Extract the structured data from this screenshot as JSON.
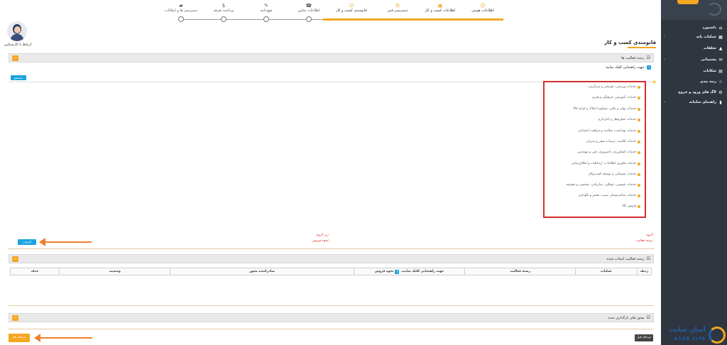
{
  "sidebar": {
    "items": [
      {
        "label": "داشبورد",
        "icon": "home-icon",
        "glyph": "⌂",
        "chevron": false
      },
      {
        "label": "عملیات پایه",
        "icon": "grid-icon",
        "glyph": "▦",
        "chevron": true
      },
      {
        "label": "تخلفات",
        "icon": "warning-icon",
        "glyph": "▲",
        "chevron": false
      },
      {
        "label": "پشتیبانی",
        "icon": "chat-icon",
        "glyph": "✉",
        "chevron": true
      },
      {
        "label": "شکایات",
        "icon": "document-icon",
        "glyph": "▤",
        "chevron": false
      },
      {
        "label": "رتبه بندی",
        "icon": "rating-icon",
        "glyph": "☆",
        "chevron": false
      },
      {
        "label": "لاگ های ورود و خروج",
        "icon": "log-icon",
        "glyph": "⚙",
        "chevron": false
      },
      {
        "label": "راهنمای سامانه",
        "icon": "help-icon",
        "glyph": "▮",
        "chevron": true
      }
    ]
  },
  "stepper": {
    "steps": [
      {
        "label": "اطلاعات هویتی",
        "glyph": "☺",
        "icon": "user-icon",
        "done": true
      },
      {
        "label": "اطلاعات کسب و کار",
        "glyph": "▣",
        "icon": "briefcase-icon",
        "done": true
      },
      {
        "label": "دسترسی فنی",
        "glyph": "⚙",
        "icon": "gears-icon",
        "done": true
      },
      {
        "label": "قانومندی کسب و کار",
        "glyph": "☑",
        "icon": "check-box-icon",
        "done": true
      },
      {
        "label": "اطلاعات تماس",
        "glyph": "☎",
        "icon": "phone-icon",
        "done": false
      },
      {
        "label": "تعهدنامه",
        "glyph": "✎",
        "icon": "edit-icon",
        "done": false
      },
      {
        "label": "پرداخت تعرفه",
        "glyph": "$",
        "icon": "dollar-icon",
        "done": false
      },
      {
        "label": "دسترسی ها و امکانات",
        "glyph": "▰",
        "icon": "folder-icon",
        "done": false
      }
    ]
  },
  "support_label": "ارتباط با کارشناس",
  "page_title": "قانومندی کسب و کار",
  "panel_activities_title": "رشته فعالیت ها",
  "hint_text": "جهت راهنمایی کلیک نمایید.",
  "hint_badge": "i",
  "search_label": "جستجو",
  "activities": [
    "خدمات ورزشی، تفریحی و سرگرمی",
    "خدمات آموزشی، فرهنگی و هنری",
    "خدمات پولی و مالی، مشاوره املاک و کرایه کالا",
    "خدمات حمل‌ونقل و انبارداری",
    "خدمات بهداشت، سلامت و مراقبت اجتماعی",
    "خدمات اقامت، ترتیبات سفر و پذیرایی",
    "خدمات کشاورزی، دامپروری، فنی و مهندسی",
    "خدمات فناوری اطلاعات، ارتباطات و اطلاع‌رسانی",
    "خدمات پشتیبانی و توسعه کسب‌وکار",
    "خدمات عمومی، تشکلی، سازمانی، شخصی و متفرقه",
    "خدمات ساخت‌وساز، نصب، تعمیر و نگهداری",
    "فروش کالا"
  ],
  "labels": {
    "group": "گروه:",
    "activity_field": "رشته فعالیت:",
    "subgroup": "زیر گروه:",
    "sale_method": "نحوه فروش:"
  },
  "add_button": "افزودن",
  "panel_selected_title": "رشته فعالیت انتخاب شده",
  "table": {
    "headers": {
      "row": "ردیف",
      "operations": "عملیات",
      "activity": "رشته فعالیت",
      "sale_method": "نحوه فروش",
      "issuer": "صادرکننده مجوز",
      "status": "وضعیت",
      "delete": "حذف"
    }
  },
  "panel_permits_title": "مجوز های بارگذاری شده",
  "prev_button": "مرحله قبل",
  "next_button": "مرحله بعد",
  "watermark": {
    "text": "آسان سایت",
    "sub": "ASAN SITE"
  },
  "colors": {
    "accent": "#f5a623",
    "primary_blue": "#1ba3e0",
    "sidebar_bg": "#2f3640",
    "highlight_red": "#d62d2d",
    "arrow_orange": "#f07f2e"
  }
}
